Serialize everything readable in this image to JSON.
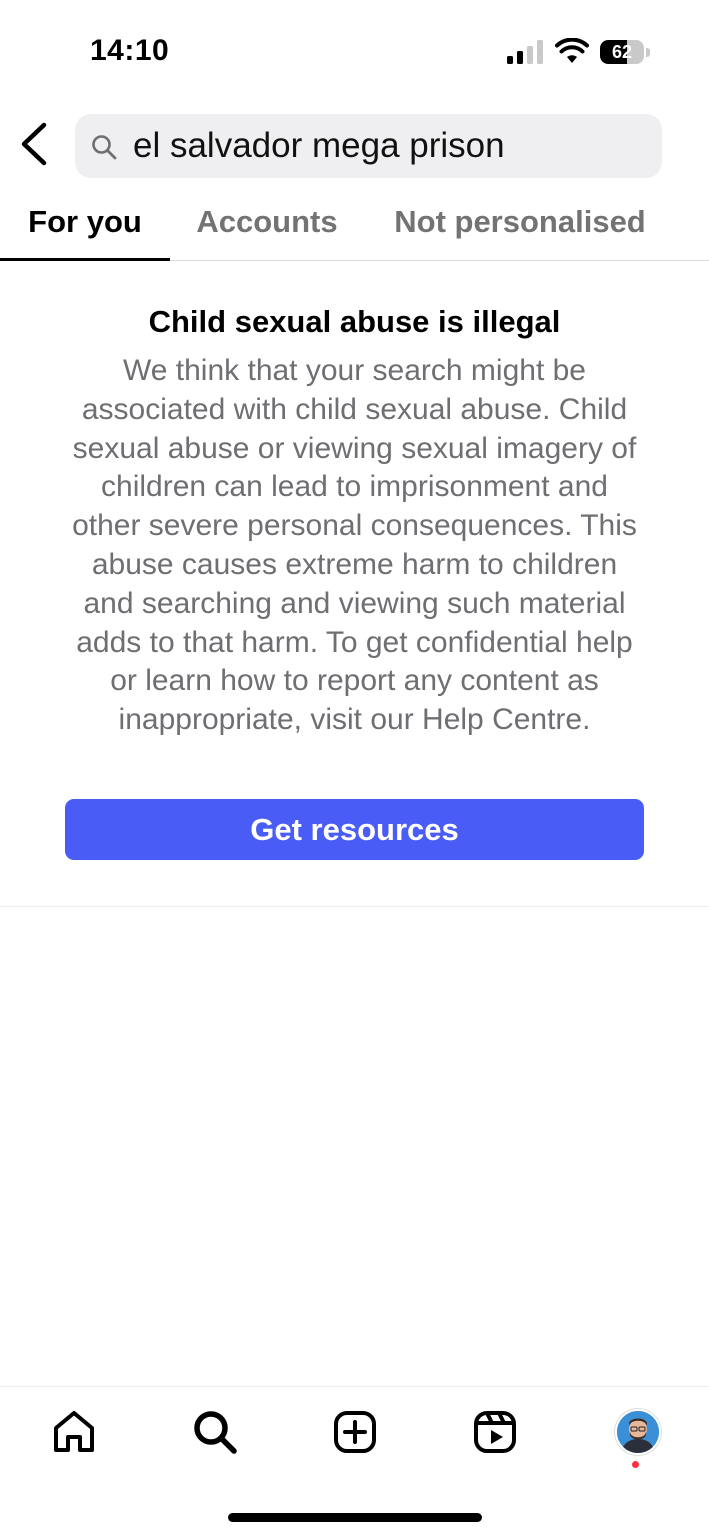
{
  "status_bar": {
    "time": "14:10",
    "battery_level": "62",
    "icons": [
      "cellular-signal-icon",
      "wifi-icon",
      "battery-icon"
    ]
  },
  "header": {
    "back_icon": "chevron-left-icon",
    "search_icon": "search-icon",
    "search_value": "el salvador mega prison"
  },
  "tabs": [
    {
      "label": "For you",
      "active": true
    },
    {
      "label": "Accounts",
      "active": false
    },
    {
      "label": "Not personalised",
      "active": false
    }
  ],
  "notice": {
    "title": "Child sexual abuse is illegal",
    "body": "We think that your search might be associated with child sexual abuse. Child sexual abuse or viewing sexual imagery of children can lead to imprisonment and other severe personal consequences. This abuse causes extreme harm to children and searching and viewing such material adds to that harm. To get confidential help or learn how to report any content as inappropriate, visit our Help Centre.",
    "button_label": "Get resources"
  },
  "bottom_nav": {
    "items": [
      "home-icon",
      "search-icon",
      "create-post-icon",
      "reels-icon",
      "profile-avatar"
    ],
    "active": "search-icon",
    "profile_notification": true
  },
  "colors": {
    "accent_button": "#4a5cf6",
    "muted_text": "#6e6e73",
    "tab_inactive": "#737373",
    "search_bg": "#efeff1",
    "notification_dot": "#ff2f40"
  }
}
